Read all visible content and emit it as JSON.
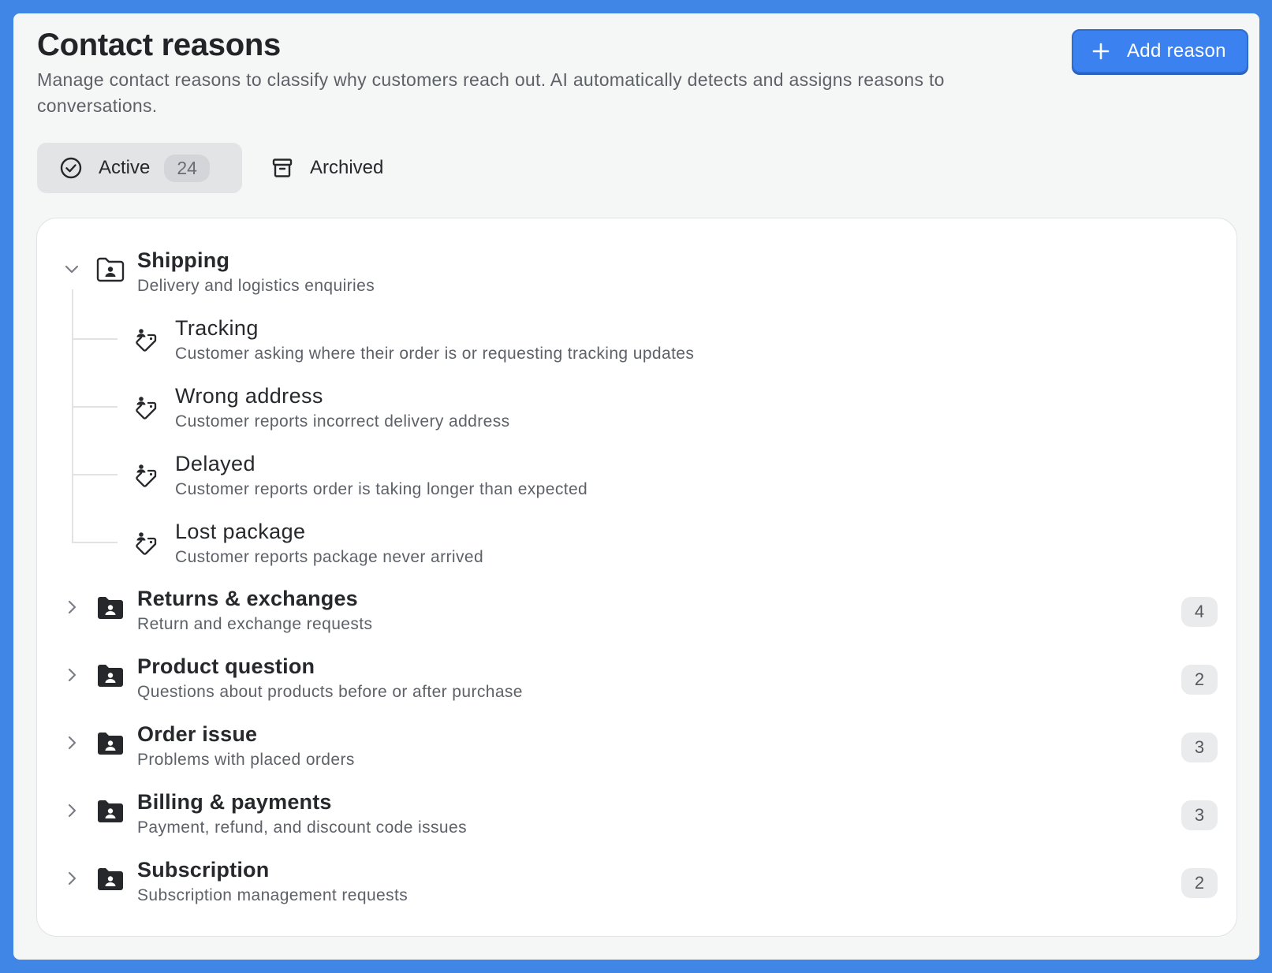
{
  "header": {
    "title": "Contact reasons",
    "subtitle": "Manage contact reasons to classify why customers reach out. AI automatically detects and assigns reasons to conversations.",
    "add_button_label": "Add reason",
    "add_button_icon": "plus-icon"
  },
  "tabs": [
    {
      "label": "Active",
      "count": "24",
      "icon": "check-circle-icon",
      "selected": true
    },
    {
      "label": "Archived",
      "icon": "archive-box-icon",
      "selected": false
    }
  ],
  "groups": [
    {
      "name": "Shipping",
      "description": "Delivery and logistics enquiries",
      "expanded": true,
      "icon": "folder-person-outline-icon",
      "items": [
        {
          "name": "Tracking",
          "description": "Customer asking where their order is or requesting tracking updates",
          "icon": "tag-person-icon"
        },
        {
          "name": "Wrong address",
          "description": "Customer reports incorrect delivery address",
          "icon": "tag-person-icon"
        },
        {
          "name": "Delayed",
          "description": "Customer reports order is taking longer than expected",
          "icon": "tag-person-icon"
        },
        {
          "name": "Lost package",
          "description": "Customer reports package never arrived",
          "icon": "tag-person-icon"
        }
      ]
    },
    {
      "name": "Returns & exchanges",
      "description": "Return and exchange requests",
      "count": "4",
      "expanded": false,
      "icon": "folder-person-filled-icon"
    },
    {
      "name": "Product question",
      "description": "Questions about products before or after purchase",
      "count": "2",
      "expanded": false,
      "icon": "folder-person-filled-icon"
    },
    {
      "name": "Order issue",
      "description": "Problems with placed orders",
      "count": "3",
      "expanded": false,
      "icon": "folder-person-filled-icon"
    },
    {
      "name": "Billing & payments",
      "description": "Payment, refund, and discount code issues",
      "count": "3",
      "expanded": false,
      "icon": "folder-person-filled-icon"
    },
    {
      "name": "Subscription",
      "description": "Subscription management requests",
      "count": "2",
      "expanded": false,
      "icon": "folder-person-filled-icon"
    }
  ],
  "colors": {
    "accent": "#3b82f0",
    "background": "#3f86e6",
    "panel": "#f5f6f6",
    "card": "#ffffff"
  }
}
